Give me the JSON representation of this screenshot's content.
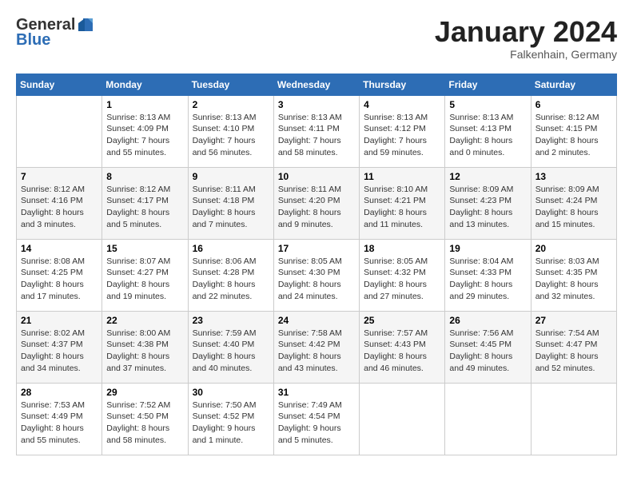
{
  "header": {
    "logo_line1": "General",
    "logo_line2": "Blue",
    "month": "January 2024",
    "location": "Falkenhain, Germany"
  },
  "weekdays": [
    "Sunday",
    "Monday",
    "Tuesday",
    "Wednesday",
    "Thursday",
    "Friday",
    "Saturday"
  ],
  "weeks": [
    [
      {
        "day": "",
        "info": ""
      },
      {
        "day": "1",
        "info": "Sunrise: 8:13 AM\nSunset: 4:09 PM\nDaylight: 7 hours\nand 55 minutes."
      },
      {
        "day": "2",
        "info": "Sunrise: 8:13 AM\nSunset: 4:10 PM\nDaylight: 7 hours\nand 56 minutes."
      },
      {
        "day": "3",
        "info": "Sunrise: 8:13 AM\nSunset: 4:11 PM\nDaylight: 7 hours\nand 58 minutes."
      },
      {
        "day": "4",
        "info": "Sunrise: 8:13 AM\nSunset: 4:12 PM\nDaylight: 7 hours\nand 59 minutes."
      },
      {
        "day": "5",
        "info": "Sunrise: 8:13 AM\nSunset: 4:13 PM\nDaylight: 8 hours\nand 0 minutes."
      },
      {
        "day": "6",
        "info": "Sunrise: 8:12 AM\nSunset: 4:15 PM\nDaylight: 8 hours\nand 2 minutes."
      }
    ],
    [
      {
        "day": "7",
        "info": "Sunrise: 8:12 AM\nSunset: 4:16 PM\nDaylight: 8 hours\nand 3 minutes."
      },
      {
        "day": "8",
        "info": "Sunrise: 8:12 AM\nSunset: 4:17 PM\nDaylight: 8 hours\nand 5 minutes."
      },
      {
        "day": "9",
        "info": "Sunrise: 8:11 AM\nSunset: 4:18 PM\nDaylight: 8 hours\nand 7 minutes."
      },
      {
        "day": "10",
        "info": "Sunrise: 8:11 AM\nSunset: 4:20 PM\nDaylight: 8 hours\nand 9 minutes."
      },
      {
        "day": "11",
        "info": "Sunrise: 8:10 AM\nSunset: 4:21 PM\nDaylight: 8 hours\nand 11 minutes."
      },
      {
        "day": "12",
        "info": "Sunrise: 8:09 AM\nSunset: 4:23 PM\nDaylight: 8 hours\nand 13 minutes."
      },
      {
        "day": "13",
        "info": "Sunrise: 8:09 AM\nSunset: 4:24 PM\nDaylight: 8 hours\nand 15 minutes."
      }
    ],
    [
      {
        "day": "14",
        "info": "Sunrise: 8:08 AM\nSunset: 4:25 PM\nDaylight: 8 hours\nand 17 minutes."
      },
      {
        "day": "15",
        "info": "Sunrise: 8:07 AM\nSunset: 4:27 PM\nDaylight: 8 hours\nand 19 minutes."
      },
      {
        "day": "16",
        "info": "Sunrise: 8:06 AM\nSunset: 4:28 PM\nDaylight: 8 hours\nand 22 minutes."
      },
      {
        "day": "17",
        "info": "Sunrise: 8:05 AM\nSunset: 4:30 PM\nDaylight: 8 hours\nand 24 minutes."
      },
      {
        "day": "18",
        "info": "Sunrise: 8:05 AM\nSunset: 4:32 PM\nDaylight: 8 hours\nand 27 minutes."
      },
      {
        "day": "19",
        "info": "Sunrise: 8:04 AM\nSunset: 4:33 PM\nDaylight: 8 hours\nand 29 minutes."
      },
      {
        "day": "20",
        "info": "Sunrise: 8:03 AM\nSunset: 4:35 PM\nDaylight: 8 hours\nand 32 minutes."
      }
    ],
    [
      {
        "day": "21",
        "info": "Sunrise: 8:02 AM\nSunset: 4:37 PM\nDaylight: 8 hours\nand 34 minutes."
      },
      {
        "day": "22",
        "info": "Sunrise: 8:00 AM\nSunset: 4:38 PM\nDaylight: 8 hours\nand 37 minutes."
      },
      {
        "day": "23",
        "info": "Sunrise: 7:59 AM\nSunset: 4:40 PM\nDaylight: 8 hours\nand 40 minutes."
      },
      {
        "day": "24",
        "info": "Sunrise: 7:58 AM\nSunset: 4:42 PM\nDaylight: 8 hours\nand 43 minutes."
      },
      {
        "day": "25",
        "info": "Sunrise: 7:57 AM\nSunset: 4:43 PM\nDaylight: 8 hours\nand 46 minutes."
      },
      {
        "day": "26",
        "info": "Sunrise: 7:56 AM\nSunset: 4:45 PM\nDaylight: 8 hours\nand 49 minutes."
      },
      {
        "day": "27",
        "info": "Sunrise: 7:54 AM\nSunset: 4:47 PM\nDaylight: 8 hours\nand 52 minutes."
      }
    ],
    [
      {
        "day": "28",
        "info": "Sunrise: 7:53 AM\nSunset: 4:49 PM\nDaylight: 8 hours\nand 55 minutes."
      },
      {
        "day": "29",
        "info": "Sunrise: 7:52 AM\nSunset: 4:50 PM\nDaylight: 8 hours\nand 58 minutes."
      },
      {
        "day": "30",
        "info": "Sunrise: 7:50 AM\nSunset: 4:52 PM\nDaylight: 9 hours\nand 1 minute."
      },
      {
        "day": "31",
        "info": "Sunrise: 7:49 AM\nSunset: 4:54 PM\nDaylight: 9 hours\nand 5 minutes."
      },
      {
        "day": "",
        "info": ""
      },
      {
        "day": "",
        "info": ""
      },
      {
        "day": "",
        "info": ""
      }
    ]
  ]
}
